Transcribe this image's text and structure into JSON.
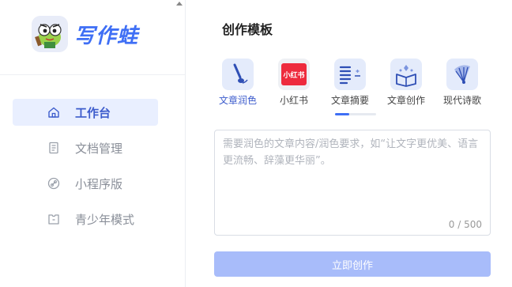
{
  "brand": {
    "name": "写作蛙",
    "accent": "#3f6ff5"
  },
  "sidebar": {
    "items": [
      {
        "label": "工作台",
        "icon": "home-icon",
        "active": true
      },
      {
        "label": "文档管理",
        "icon": "document-icon",
        "active": false
      },
      {
        "label": "小程序版",
        "icon": "link-icon",
        "active": false
      },
      {
        "label": "青少年模式",
        "icon": "youth-mode-icon",
        "active": false
      }
    ]
  },
  "main": {
    "title": "创作模板",
    "tabs": [
      {
        "label": "文章润色",
        "icon": "brush-icon",
        "active": true
      },
      {
        "label": "小红书",
        "icon": "xiaohongshu-icon",
        "badge": "小红书",
        "active": false
      },
      {
        "label": "文章摘要",
        "icon": "summary-icon",
        "active": false
      },
      {
        "label": "文章创作",
        "icon": "book-icon",
        "active": false
      },
      {
        "label": "现代诗歌",
        "icon": "fan-icon",
        "active": false
      }
    ],
    "input": {
      "value": "",
      "placeholder": "需要润色的文章内容/润色要求，如“让文字更优美、语言更流畅、辞藻更华丽”。",
      "counter": "0 / 500"
    },
    "submit_label": "立即创作"
  }
}
